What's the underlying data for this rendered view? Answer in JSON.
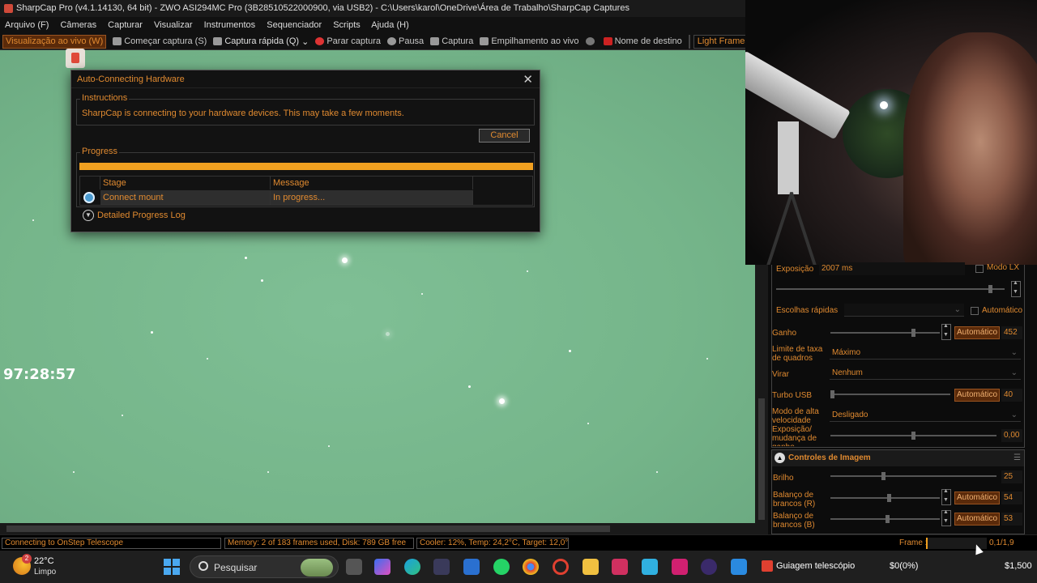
{
  "window": {
    "title": "SharpCap Pro (v4.1.14130, 64 bit) - ZWO ASI294MC Pro (3B28510522000900, via USB2) - C:\\Users\\karol\\OneDrive\\Área de Trabalho\\SharpCap Captures"
  },
  "menu": [
    "Arquivo (F)",
    "Câmeras",
    "Capturar",
    "Visualizar",
    "Instrumentos",
    "Sequenciador",
    "Scripts",
    "Ajuda (H)"
  ],
  "toolbar": {
    "live_view": "Visualização ao vivo (W)",
    "start_capture": "Começar captura (S)",
    "quick_capture": "Captura rápida (Q)",
    "stop_capture": "Parar captura",
    "pause": "Pausa",
    "snapshot": "Captura",
    "live_stack": "Empilhamento ao vivo",
    "target_name": "Nome de destino",
    "frame_type": "Light Frames"
  },
  "viewer": {
    "timer": "97:28:57"
  },
  "dialog": {
    "title": "Auto-Connecting Hardware",
    "instructions_label": "Instructions",
    "instructions_text": "SharpCap is connecting to your hardware devices. This may take a few moments.",
    "cancel_label": "Cancel",
    "progress_label": "Progress",
    "progress_fraction": 1.0,
    "table_headers": {
      "stage": "Stage",
      "message": "Message"
    },
    "row": {
      "stage": "Connect mount",
      "message": "In progress..."
    },
    "detailed_log": "Detailed Progress Log"
  },
  "camera_panel": {
    "exposure_label": "Exposição",
    "exposure_value": "2007 ms",
    "lx_mode": "Modo LX",
    "quick_picks": "Escolhas rápidas",
    "quick_picks_auto": "Automático",
    "gain_label": "Ganho",
    "gain_auto": "Automático",
    "gain_value": "452",
    "frame_rate_label": "Limite de taxa de quadros",
    "frame_rate_value": "Máximo",
    "flip_label": "Virar",
    "flip_value": "Nenhum",
    "usb_label": "Turbo USB",
    "usb_auto": "Automático",
    "usb_value": "40",
    "highspeed_label": "Modo de alta velocidade",
    "highspeed_value": "Desligado",
    "exposure_gain_label": "Exposição/ mudança de ganho",
    "exposure_gain_value": "0,00",
    "image_controls_title": "Controles de Imagem",
    "brightness_label": "Brilho",
    "brightness_value": "25",
    "wb_r_label": "Balanço de brancos (R)",
    "wb_r_auto": "Automático",
    "wb_r_value": "54",
    "wb_b_label": "Balanço de brancos (B)",
    "wb_b_auto": "Automático",
    "wb_b_value": "53"
  },
  "status": {
    "connection": "Connecting to OnStep Telescope",
    "memory": "Memory: 2 of 183 frames used, Disk: 789 GB free",
    "cooler": "Cooler: 12%, Temp: 24,2°C, Target: 12,0°C",
    "frame_label": "Frame :",
    "frame_value": "0,1/1,9"
  },
  "taskbar": {
    "weather_badge": "2",
    "temperature": "22°C",
    "condition": "Limpo",
    "search_placeholder": "Pesquisar",
    "tray_app_label": "Guiagem telescópio",
    "money_left": "$0(0%)",
    "money_right": "$1,500"
  },
  "colors": {
    "accent": "#e08a30",
    "progress": "#f0a020",
    "sky": "#75b58a"
  }
}
